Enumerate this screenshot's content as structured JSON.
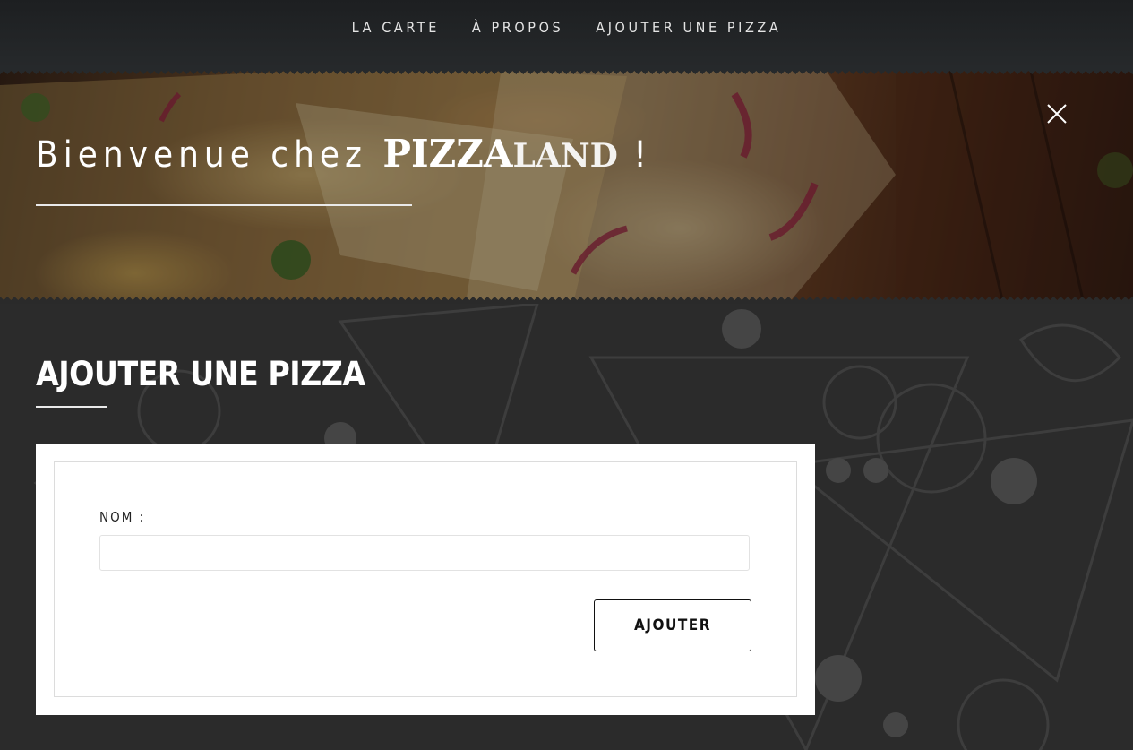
{
  "nav": {
    "items": [
      {
        "label": "LA CARTE"
      },
      {
        "label": "À PROPOS"
      },
      {
        "label": "AJOUTER UNE PIZZA"
      }
    ]
  },
  "hero": {
    "greeting": "Bienvenue chez",
    "brand_bold": "PIZZA",
    "brand_light": "LAND",
    "exclamation": "!",
    "close_icon": "close-icon"
  },
  "page": {
    "title": "AJOUTER UNE PIZZA"
  },
  "form": {
    "name_label": "NOM :",
    "name_value": "",
    "name_placeholder": "",
    "submit_label": "AJOUTER"
  },
  "colors": {
    "page_background": "#2a2a2a",
    "nav_background": "#1d1f21",
    "text_light": "#ffffff",
    "card_background": "#ffffff"
  }
}
